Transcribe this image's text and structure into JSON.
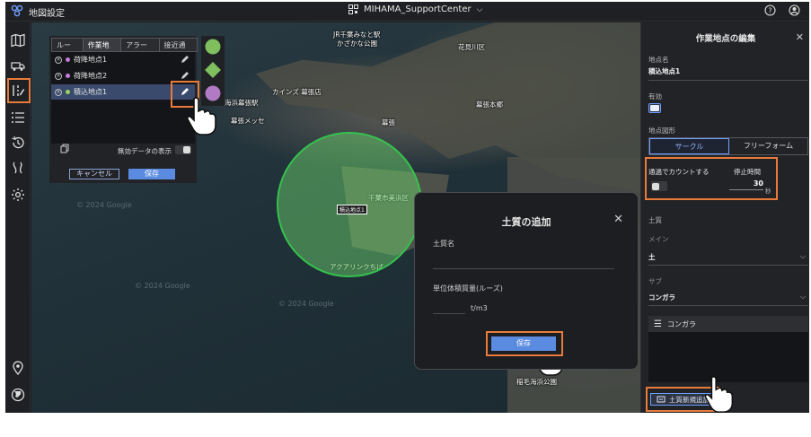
{
  "app": {
    "title": "地図設定",
    "site": "MIHAMA_SupportCenter"
  },
  "route_panel": {
    "tabs": [
      "ルート",
      "作業地点",
      "アラート",
      "接近通知"
    ],
    "active_tab": 1,
    "points": [
      {
        "name": "荷降地点1",
        "color": "#c77ddb"
      },
      {
        "name": "荷降地点2",
        "color": "#c77ddb"
      },
      {
        "name": "積込地点1",
        "color": "#9ad45c"
      }
    ],
    "invalid_label": "無効データの表示",
    "cancel_label": "キャンセル",
    "save_label": "保存"
  },
  "map": {
    "labels": [
      "JR千葉みなと駅",
      "かざかな公園",
      "花見川区",
      "幕張本郷",
      "幕張",
      "海浜幕張駅",
      "カインズ 幕張店",
      "幕張メッセ",
      "アクアリンクちば",
      "千葉市美浜区",
      "稲毛海浜公園",
      "積込地点1"
    ],
    "watermark": "© 2024 Google"
  },
  "soil_dialog": {
    "title": "土質の追加",
    "name_label": "土質名",
    "density_label": "単位体積質量(ルーズ)",
    "unit": "t/m3",
    "save_label": "保存"
  },
  "edit_panel": {
    "title": "作業地点の編集",
    "name_label": "地点名",
    "name_value": "積込地点1",
    "enabled_label": "有効",
    "shape_label": "地点図形",
    "shape_options": [
      "サークル",
      "フリーフォーム"
    ],
    "shape_selected": "サークル",
    "count_label": "通過でカウントする",
    "stop_label": "停止時間",
    "stop_value": "30",
    "stop_unit": "秒",
    "soil_label": "土質",
    "main_label": "メイン",
    "main_value": "土",
    "sub_label": "サブ",
    "sub_value": "コンガラ",
    "list_item": "コンガラ",
    "add_label": "土質新規追加"
  }
}
